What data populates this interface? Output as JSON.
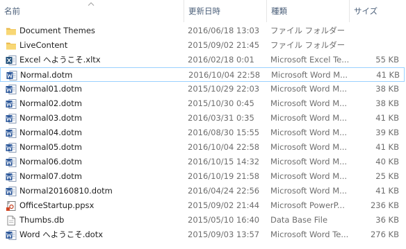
{
  "columns": {
    "name": "名前",
    "date": "更新日時",
    "type": "種類",
    "size": "サイズ"
  },
  "files": [
    {
      "name": "Document Themes",
      "date": "2016/06/18 13:03",
      "type": "ファイル フォルダー",
      "size": "",
      "icon": "folder-icon"
    },
    {
      "name": "LiveContent",
      "date": "2015/09/02 21:45",
      "type": "ファイル フォルダー",
      "size": "",
      "icon": "folder-icon"
    },
    {
      "name": "Excel へようこそ.xltx",
      "date": "2016/02/18 0:01",
      "type": "Microsoft Excel Te...",
      "size": "55 KB",
      "icon": "excel-icon"
    },
    {
      "name": "Normal.dotm",
      "date": "2016/10/04 22:58",
      "type": "Microsoft Word M...",
      "size": "41 KB",
      "icon": "word-icon"
    },
    {
      "name": "Normal01.dotm",
      "date": "2015/10/29 22:03",
      "type": "Microsoft Word M...",
      "size": "38 KB",
      "icon": "word-icon"
    },
    {
      "name": "Normal02.dotm",
      "date": "2015/10/30 0:45",
      "type": "Microsoft Word M...",
      "size": "38 KB",
      "icon": "word-icon"
    },
    {
      "name": "Normal03.dotm",
      "date": "2016/03/31 0:35",
      "type": "Microsoft Word M...",
      "size": "41 KB",
      "icon": "word-icon"
    },
    {
      "name": "Normal04.dotm",
      "date": "2016/08/30 15:55",
      "type": "Microsoft Word M...",
      "size": "39 KB",
      "icon": "word-icon"
    },
    {
      "name": "Normal05.dotm",
      "date": "2016/10/04 22:58",
      "type": "Microsoft Word M...",
      "size": "41 KB",
      "icon": "word-icon"
    },
    {
      "name": "Normal06.dotm",
      "date": "2016/10/15 14:32",
      "type": "Microsoft Word M...",
      "size": "40 KB",
      "icon": "word-icon"
    },
    {
      "name": "Normal07.dotm",
      "date": "2016/10/19 21:58",
      "type": "Microsoft Word M...",
      "size": "25 KB",
      "icon": "word-icon"
    },
    {
      "name": "Normal20160810.dotm",
      "date": "2016/04/24 22:56",
      "type": "Microsoft Word M...",
      "size": "41 KB",
      "icon": "word-icon"
    },
    {
      "name": "OfficeStartup.ppsx",
      "date": "2015/09/02 21:44",
      "type": "Microsoft PowerP...",
      "size": "236 KB",
      "icon": "powerpoint-icon"
    },
    {
      "name": "Thumbs.db",
      "date": "2015/05/10 16:40",
      "type": "Data Base File",
      "size": "36 KB",
      "icon": "database-file-icon"
    },
    {
      "name": "Word へようこそ.dotx",
      "date": "2015/09/03 13:57",
      "type": "Microsoft Word Te...",
      "size": "276 KB",
      "icon": "word-icon"
    }
  ],
  "selected_index": 3,
  "colors": {
    "header_text": "#4c607a",
    "selection_border": "#99d1ff",
    "folder": "#f4cd6a",
    "word": "#2b579a",
    "excel": "#217346"
  }
}
